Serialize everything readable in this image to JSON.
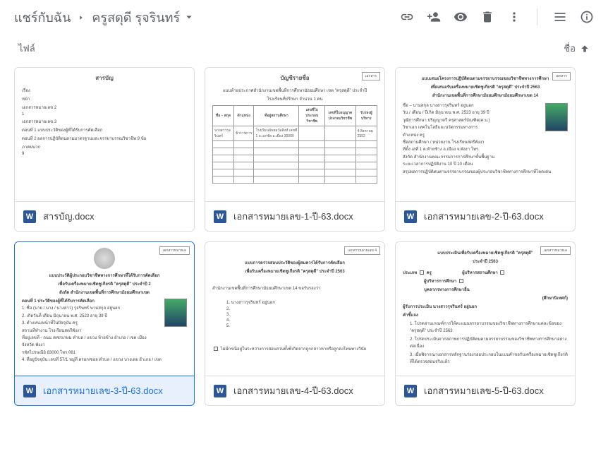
{
  "header": {
    "breadcrumb_root": "แชร์กับฉัน",
    "breadcrumb_current": "ครูสดุดี รุจรินทร์"
  },
  "subheader": {
    "files_label": "ไฟล์",
    "sort_label": "ชื่อ"
  },
  "files": [
    {
      "name": "สารบัญ.docx",
      "selected": false,
      "thumb_type": "toc"
    },
    {
      "name": "เอกสารหมายเลข-1-ปี-63.docx",
      "selected": false,
      "thumb_type": "table"
    },
    {
      "name": "เอกสารหมายเลข-2-ปี-63.docx",
      "selected": false,
      "thumb_type": "profile"
    },
    {
      "name": "เอกสารหมายเลข-3-ปี-63.docx",
      "selected": true,
      "thumb_type": "profile2"
    },
    {
      "name": "เอกสารหมายเลข-4-ปี-63.docx",
      "selected": false,
      "thumb_type": "form4"
    },
    {
      "name": "เอกสารหมายเลข-5-ปี-63.docx",
      "selected": false,
      "thumb_type": "form5"
    }
  ],
  "thumbs": {
    "toc": {
      "title": "สารบัญ",
      "lines": [
        "เรื่อง",
        "หน้า",
        "",
        "เอกสารหมายเลข 2",
        "    1",
        "เอกสารหมายเลข 3",
        "",
        "    ตอนที่ 1  แบบประวัติของผู้ที่ได้รับการคัดเลือก",
        "",
        "    ตอนที่ 2  ผลการปฏิบัติตนตามมาตรฐานและจรรยาบรรณวิชาชีพ 9 ข้อ",
        "",
        "ภาคผนวก",
        "    9"
      ]
    },
    "table": {
      "tag": "เอกสาร",
      "title": "บัญชีรายชื่อ",
      "sub": "แนบท้ายประกาศสำนักงานเขตพื้นที่การศึกษามัธยมศึกษา เขต \"ครุสดุดี\" ประจำปี",
      "sub2": "โรงเรียนที่ปรึกษา จำนวน 1 คน",
      "headers": [
        "ชื่อ – สกุล",
        "ตำแหน่ง",
        "ที่อยู่สถานศึกษา",
        "เลขที่ใบประกอบวิชาชีพ",
        "เลขที่ใบอนุญาตประกอบวิชาชีพ",
        "รับรองผู้บริหาร"
      ],
      "row": [
        "นางสาวรุจรินทร์",
        "ข้าราชการ",
        "โรงเรียนมัธยมวัดสิงห์ เลขที่ 1 ถ.เอกชัย อ.เมือง 30000",
        "",
        "",
        "4 สิงหาคม 2552"
      ]
    },
    "profile": {
      "tag": "เอกสาร",
      "title": "แบบเสนอโครงการปฏิบัติตนตามจรรยาบรรณของวิชาชีพทางการศึกษา",
      "sub1": "เพื่อเสนอรับเครื่องหมายเชิดชูเกียรติ \"ครุสดุดี\" ประจำปี 2563",
      "sub2": "สำนักงานเขตพื้นที่การศึกษามัธยมศึกษามัธยมศึกษาเขต 14",
      "lines": [
        "ชื่อ – นามสกุล นางสาวรุจรินทร์  อยู่นอก",
        "วัน / เดือน / ปีเกิด  มิถุนายน  พ.ศ. 2523  อายุ 39 ปี",
        "วุฒิการศึกษา ปริญญาตรี  ครุศาสตร์บัณฑิต(ค.บ.)",
        "วิชาเอก  เทคโนโลยีและนวัตกรรมทางการ",
        "",
        "ตำแหน่ง ครู",
        "ชื่อสถานศึกษา / หน่วยงาน โรงเรียนสตรีพังงา",
        "ที่ตั้ง เลที่ 1 ต.ท้ายช้าง อ.เมือง จ.พังงา  โทร.",
        "สังกัด สำนักงานคณะกรรมการการศึกษาขั้นพื้นฐาน",
        "ระยะเวลาการปฏิบัติงาน 10 ปี  10 เดือน",
        "",
        "สรุปผลการปฏิบัติตนตามจรรยาบรรณของผู้ประกอบวิชาชีพทางการศึกษาที่โดดเด่น"
      ]
    },
    "profile2": {
      "tag": "เอกสารหมายเล",
      "title": "แบบประวัติผู้ประกอบวิชาชีพทางการศึกษาที่ได้รับการคัดเลือก",
      "sub1": "เพื่อรับเครื่องหมายเชิดชูเกียรติ \"ครุสดุดี\" ประจำปี 2",
      "sub2": "สังกัด สำนักงานเขตพื้นที่การศึกษามัธยมศึกษาเขต",
      "section": "ตอนที่ 1   ประวัติของผู้ที่ได้รับการคัดเลือก",
      "lines": [
        "1. ชื่อ (นาย / นาง / นางสาว) รุจรินทร์    นามสกุล อยู่นอก",
        "2. เกิดวันที่    เดือน มิถุนายน  พ.ศ. 2523  อายุ 39 ปี",
        "3. ตำแหน่งหน้าที่ในปัจจุบัน ครู",
        "   สถานที่ทำงาน โรงเรียนสตรีพังงา",
        "   ที่อยู่เลขที่ -  ถนน เพชรเกษม  ตำบล / แขวง ท้ายช้าง อำเภอ / เขต เมือง",
        "   จังหวัด พังงา",
        "   รหัสไปรษณีย์ 83000  โทร 081",
        "4. ที่อยู่ปัจจุบัน เลขที่  57/1  หมู่ที่ ตรอก/ซอย   ตำบล / แขวง บางเตย อำเภอ / เขต"
      ]
    },
    "form4": {
      "tag": "เอกสารหมายเลข 4",
      "title": "แบบการตรวจสอบประวัติของผู้สมควรได้รับการคัดเลือก",
      "sub": "เพื่อรับเครื่องหมายเชิดชูเกียรติ \"ครุสดุดี\" ประจำปี 2563",
      "line1": "สำนักงานเขตพื้นที่การศึกษามัธยมศึกษาเขต 14   ขอรับรองว่า",
      "items": [
        "1.  นางสาวรุจรินทร์  อยู่นอก",
        "2.",
        "3.",
        "4.",
        "5."
      ],
      "note": "ไม่มีกรณีอยู่ในระหว่างการสอบสวนทั้งที่เกิดจากถูกกล่าวหาหรือถูกลงโทษทางวินัย"
    },
    "form5": {
      "tag": "เอกสารหมายเล",
      "title": "แบบประเมินเพื่อรับเครื่องหมายเชิดชูเกียรติ \"ครุสดุดี\"",
      "sub": "ประจำปี 2563",
      "row1_label": "ประเภท",
      "row1_opt1": "ครู",
      "row1_opt2": "ผู้บริหารสถานศึกษา",
      "row2_opt1": "ผู้บริหารการศึกษา",
      "row3_opt1": "บุคลากรทางการศึกษาอื่น",
      "row3_right": "(ศึกษานิเทศก์)",
      "name_label": "ผู้รับการประเมิน นางสาวรุจรินทร์  อยู่นอก",
      "explain": "คำชี้แจง",
      "ex_lines": [
        "1. โปรดอ่านเกณฑ์การให้คะแนนจรรยาบรรณของวิชาชีพทางการศึกษาแต่ละข้อของ \"ครุสดุดี\" ประจำปี 2563",
        "2. โปรดประเมินจากสภาพการปฏิบัติตนตามจรรยาบรรณของวิชาชีพทางการศึกษาอย่างต่อเนื่อง",
        "3. เมื่อพิจารณาเอกสารหลักฐานร่องรอยประกอบในแบบคำขอรับเครื่องหมายเชิดชูเกียรติที่ได้ตรวจสอบจริงแล้ว"
      ]
    }
  }
}
